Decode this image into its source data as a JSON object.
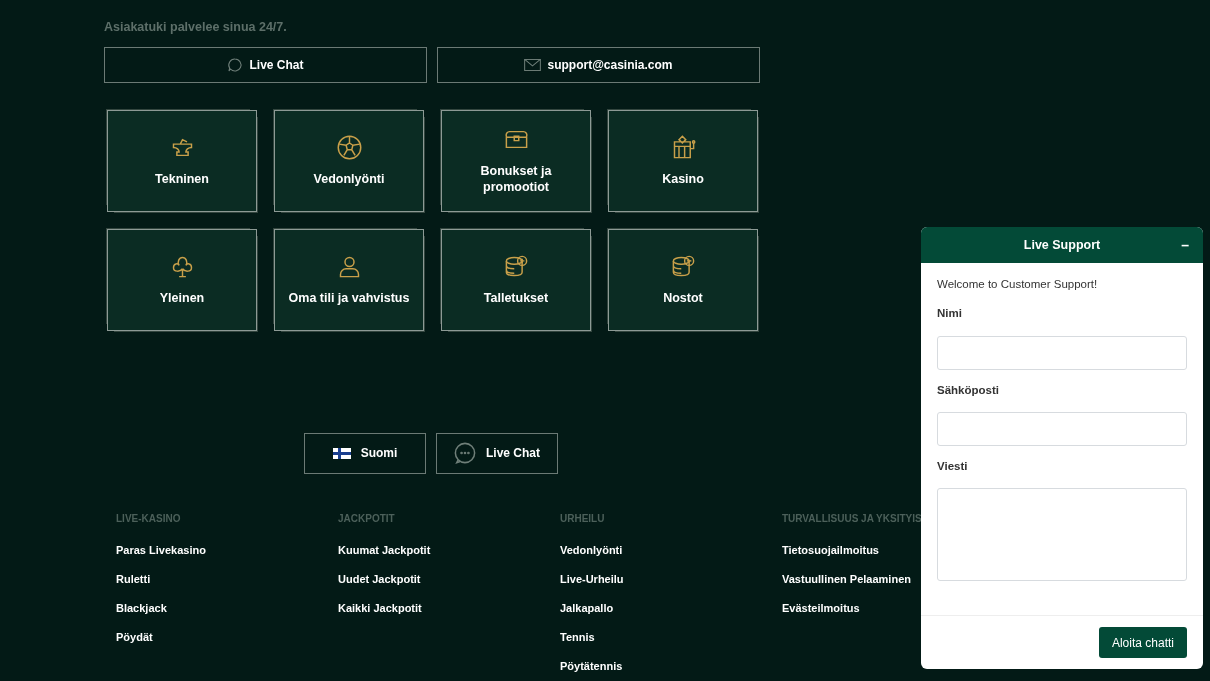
{
  "intro": "Asiakatuki palvelee sinua 24/7.",
  "contact_buttons": [
    {
      "kind": "chat",
      "label": "Live Chat"
    },
    {
      "kind": "mail",
      "label": "support@casinia.com"
    }
  ],
  "categories": [
    {
      "kind": "anvil",
      "label": "Tekninen"
    },
    {
      "kind": "ball",
      "label": "Vedonlyönti"
    },
    {
      "kind": "chest",
      "label": "Bonukset ja promootiot"
    },
    {
      "kind": "slot",
      "label": "Kasino"
    },
    {
      "kind": "club",
      "label": "Yleinen"
    },
    {
      "kind": "person",
      "label": "Oma tili ja vahvistus"
    },
    {
      "kind": "coins-plus",
      "label": "Talletukset"
    },
    {
      "kind": "coins-minus",
      "label": "Nostot"
    }
  ],
  "footer_buttons": [
    {
      "kind": "flag",
      "label": "Suomi"
    },
    {
      "kind": "chat",
      "label": "Live Chat"
    }
  ],
  "footer_columns": [
    {
      "heading": "LIVE-KASINO",
      "links": [
        "Paras Livekasino",
        "Ruletti",
        "Blackjack",
        "Pöydät"
      ]
    },
    {
      "heading": "JACKPOTIT",
      "links": [
        "Kuumat Jackpotit",
        "Uudet Jackpotit",
        "Kaikki Jackpotit"
      ]
    },
    {
      "heading": "URHEILU",
      "links": [
        "Vedonlyönti",
        "Live-Urheilu",
        "Jalkapallo",
        "Tennis",
        "Pöytätennis"
      ]
    },
    {
      "heading": "TURVALLISUUS JA YKSITYIS",
      "links": [
        "Tietosuojailmoitus",
        "Vastuullinen Pelaaminen",
        "Evästeilmoitus"
      ]
    }
  ],
  "chat_widget": {
    "title": "Live Support",
    "minimize": "–",
    "welcome": "Welcome to Customer Support!",
    "fields": [
      {
        "kind": "input",
        "label": "Nimi"
      },
      {
        "kind": "input",
        "label": "Sähköposti"
      },
      {
        "kind": "textarea",
        "label": "Viesti"
      }
    ],
    "submit": "Aloita chatti"
  }
}
